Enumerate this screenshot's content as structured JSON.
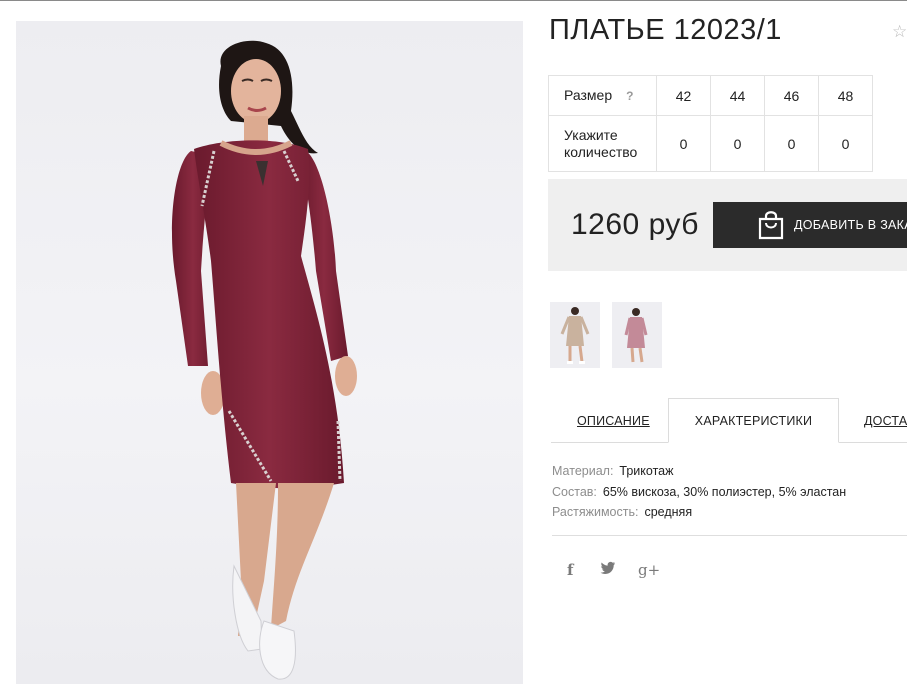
{
  "product": {
    "title": "ПЛАТЬЕ 12023/1",
    "favorite_icon": "star-icon"
  },
  "size_table": {
    "size_label": "Размер",
    "help_mark": "?",
    "quantity_label_line1": "Укажите",
    "quantity_label_line2": "количество",
    "sizes": [
      "42",
      "44",
      "46",
      "48"
    ],
    "quantities": [
      "0",
      "0",
      "0",
      "0"
    ]
  },
  "purchase": {
    "price": "1260 руб",
    "add_to_cart_label": "ДОБАВИТЬ В ЗАКАЗ",
    "cart_icon": "shopping-bag-icon"
  },
  "tabs": {
    "description": "ОПИСАНИЕ",
    "characteristics": "ХАРАКТЕРИСТИКИ",
    "delivery": "ДОСТАВКА",
    "active": "characteristics"
  },
  "characteristics": [
    {
      "key": "Материал:",
      "value": "Трикотаж"
    },
    {
      "key": "Состав:",
      "value": "65% вискоза, 30% полиэстер, 5% эластан"
    },
    {
      "key": "Растяжимость:",
      "value": "средняя"
    }
  ],
  "social": {
    "facebook": "f",
    "twitter": "t",
    "googleplus": "g+"
  },
  "colors": {
    "dress": "#7c1f35",
    "button_bg": "#2b2b2b",
    "price_box_bg": "#efefef"
  }
}
